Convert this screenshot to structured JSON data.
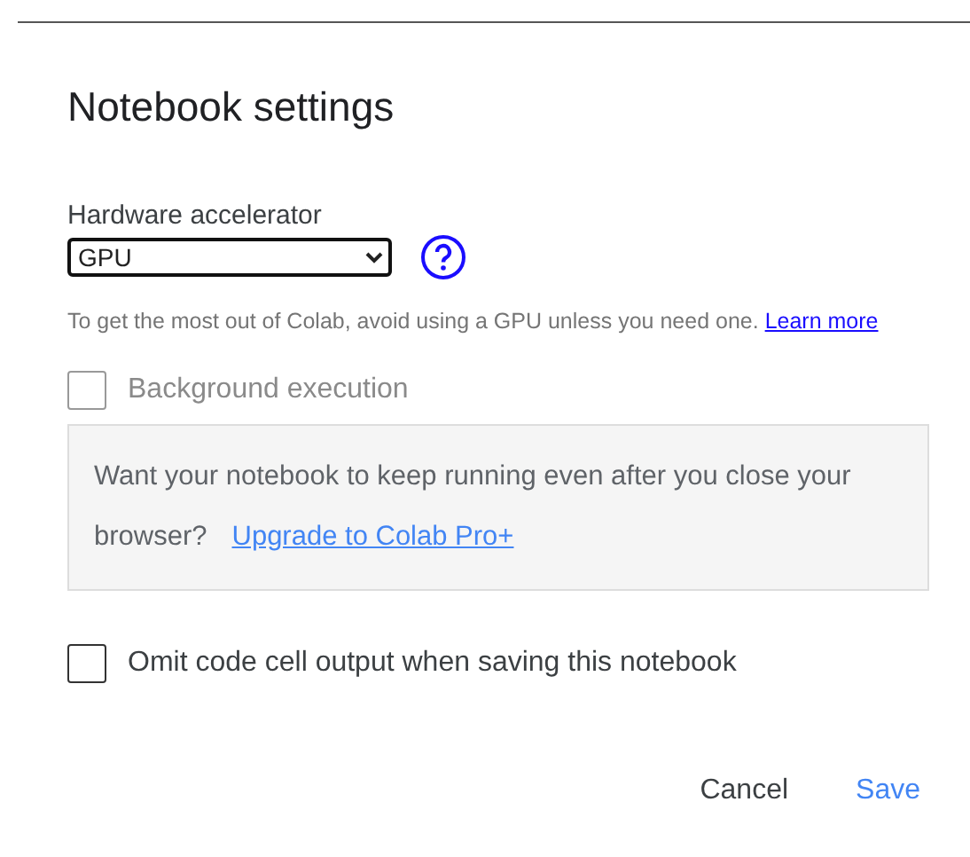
{
  "dialog": {
    "title": "Notebook settings"
  },
  "accelerator": {
    "label": "Hardware accelerator",
    "value": "GPU",
    "hint": "To get the most out of Colab, avoid using a GPU unless you need one.",
    "link": "Learn more"
  },
  "options": [
    {
      "label": "Background execution",
      "checked": false,
      "disabled": true
    },
    {
      "label": "Omit code cell output when saving this notebook",
      "checked": false,
      "disabled": false
    }
  ],
  "upsell": {
    "text": "Want your notebook to keep running even after you close your browser?",
    "link": "Upgrade to Colab Pro+"
  },
  "buttons": [
    {
      "label": "Cancel",
      "kind": "secondary"
    },
    {
      "label": "Save",
      "kind": "primary"
    }
  ]
}
